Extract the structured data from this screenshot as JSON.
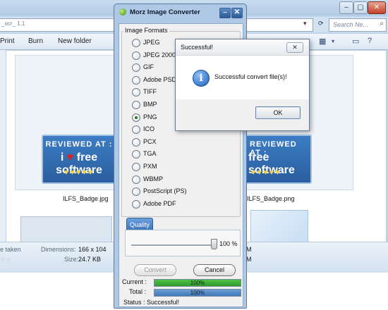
{
  "explorer": {
    "address_partial": "_ocr_ 1.1",
    "search_placeholder": "Search Ne...",
    "toolbar": {
      "print_label": "Print",
      "burn_label": "Burn",
      "new_folder_label": "New folder"
    },
    "badge": {
      "top_text": "REVIEWED AT :",
      "main_text_left": "i",
      "main_text_right": "free software",
      "main_text_partial": "free software",
      "hearts": "♥♥♥♥♥"
    },
    "files": [
      {
        "name": "ILFS_Badge.jpg"
      },
      {
        "name": "ILFS_Badge.png"
      }
    ],
    "status": {
      "date_taken_key": "e taken",
      "dimensions_key": "Dimensions:",
      "dimensions_value": "166 x 104",
      "size_key": "Size:",
      "size_value": "24.7 KB",
      "right_partial_1": "M",
      "right_partial_2": "M"
    }
  },
  "converter": {
    "title": "Morz Image Converter",
    "group_label": "Image Formats",
    "formats": [
      {
        "label": "JPEG",
        "checked": false
      },
      {
        "label": "JPEG 2000",
        "checked": false
      },
      {
        "label": "GIF",
        "checked": false
      },
      {
        "label": "Adobe PSD",
        "checked": false
      },
      {
        "label": "TIFF",
        "checked": false
      },
      {
        "label": "BMP",
        "checked": false
      },
      {
        "label": "PNG",
        "checked": true
      },
      {
        "label": "ICO",
        "checked": false
      },
      {
        "label": "PCX",
        "checked": false
      },
      {
        "label": "TGA",
        "checked": false
      },
      {
        "label": "PXM",
        "checked": false
      },
      {
        "label": "WBMP",
        "checked": false
      },
      {
        "label": "PostScript (PS)",
        "checked": false
      },
      {
        "label": "Adobe PDF",
        "checked": false
      }
    ],
    "quality_tab": "Quality",
    "quality_value_text": "100 %",
    "quality_value": 100,
    "convert_label": "Convert",
    "cancel_label": "Cancel",
    "current_label": "Current :",
    "current_text": "100%",
    "current_progress": 1.0,
    "total_label": "Total :",
    "total_text": "100%",
    "total_progress": 1.0,
    "status_text": "Status :  Successful!"
  },
  "dialog": {
    "title": "Successful!",
    "message": "Successful convert file(s)!",
    "ok_label": "OK",
    "close_symbol": "✕"
  },
  "colors": {
    "current_bar": "#4fc34a",
    "total_bar": "#6d9fd6"
  }
}
